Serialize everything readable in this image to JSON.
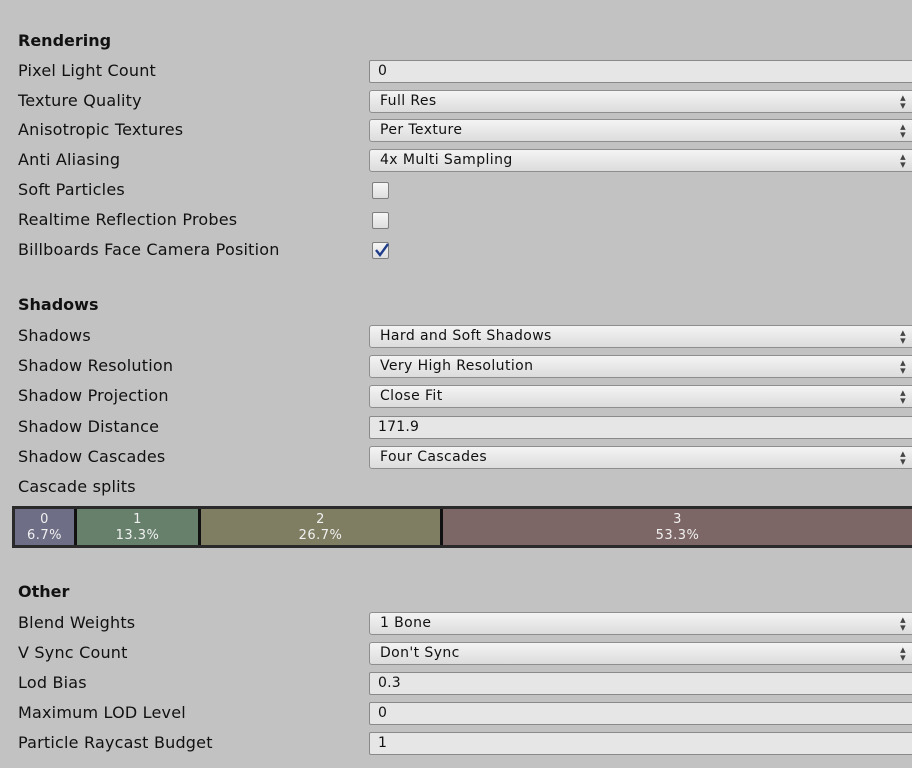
{
  "rendering": {
    "header": "Rendering",
    "pixel_light_count": {
      "label": "Pixel Light Count",
      "value": "0"
    },
    "texture_quality": {
      "label": "Texture Quality",
      "value": "Full Res"
    },
    "anisotropic_textures": {
      "label": "Anisotropic Textures",
      "value": "Per Texture"
    },
    "anti_aliasing": {
      "label": "Anti Aliasing",
      "value": "4x Multi Sampling"
    },
    "soft_particles": {
      "label": "Soft Particles",
      "checked": false
    },
    "realtime_reflection_probes": {
      "label": "Realtime Reflection Probes",
      "checked": false
    },
    "billboards_face_camera": {
      "label": "Billboards Face Camera Position",
      "checked": true
    }
  },
  "shadows": {
    "header": "Shadows",
    "shadows": {
      "label": "Shadows",
      "value": "Hard and Soft Shadows"
    },
    "shadow_resolution": {
      "label": "Shadow Resolution",
      "value": "Very High Resolution"
    },
    "shadow_projection": {
      "label": "Shadow Projection",
      "value": "Close Fit"
    },
    "shadow_distance": {
      "label": "Shadow Distance",
      "value": "171.9"
    },
    "shadow_cascades": {
      "label": "Shadow Cascades",
      "value": "Four Cascades"
    },
    "cascade_splits": {
      "label": "Cascade splits",
      "segments": [
        {
          "index": "0",
          "percent": "6.7%",
          "color": "#6e6e86"
        },
        {
          "index": "1",
          "percent": "13.3%",
          "color": "#67806b"
        },
        {
          "index": "2",
          "percent": "26.7%",
          "color": "#7f7e63"
        },
        {
          "index": "3",
          "percent": "53.3%",
          "color": "#7d6666"
        }
      ]
    }
  },
  "other": {
    "header": "Other",
    "blend_weights": {
      "label": "Blend Weights",
      "value": "1 Bone"
    },
    "v_sync_count": {
      "label": "V Sync Count",
      "value": "Don't Sync"
    },
    "lod_bias": {
      "label": "Lod Bias",
      "value": "0.3"
    },
    "maximum_lod_level": {
      "label": "Maximum LOD Level",
      "value": "0"
    },
    "particle_raycast_budget": {
      "label": "Particle Raycast Budget",
      "value": "1"
    }
  },
  "icons": {
    "dropdown_arrows": "up-down-arrows-icon",
    "checkmark": "checkmark-icon"
  }
}
